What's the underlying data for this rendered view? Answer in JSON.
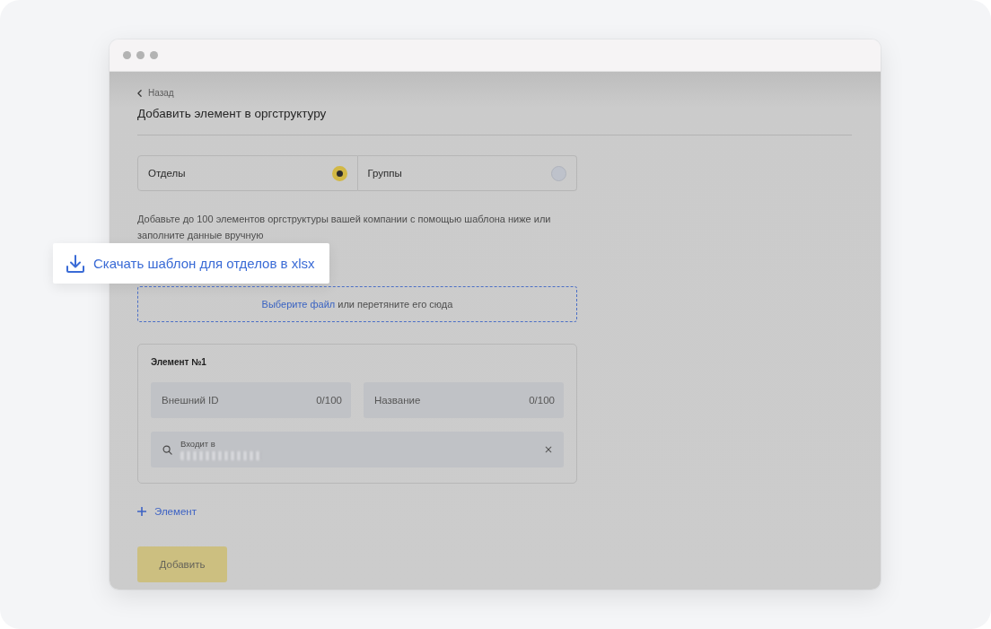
{
  "back_link": {
    "label": "Назад"
  },
  "title": "Добавить элемент в оргструктуру",
  "type_options": [
    {
      "label": "Отделы",
      "selected": true
    },
    {
      "label": "Группы",
      "selected": false
    }
  ],
  "description": "Добавьте до 100 элементов оргструктуры вашей компании с помощью шаблона ниже или заполните данные вручную",
  "download_template": {
    "label": "Скачать шаблон для отделов в xlsx"
  },
  "dropzone": {
    "link": "Выберите файл",
    "text": "или перетяните его сюда"
  },
  "elements": [
    {
      "title": "Элемент №1",
      "fields": [
        {
          "placeholder": "Внешний ID",
          "counter": "0/100"
        },
        {
          "placeholder": "Название",
          "counter": "0/100"
        }
      ],
      "parent_field": {
        "label": "Входит в"
      }
    }
  ],
  "add_element": {
    "label": "Элемент"
  },
  "submit_button": {
    "label": "Добавить"
  }
}
